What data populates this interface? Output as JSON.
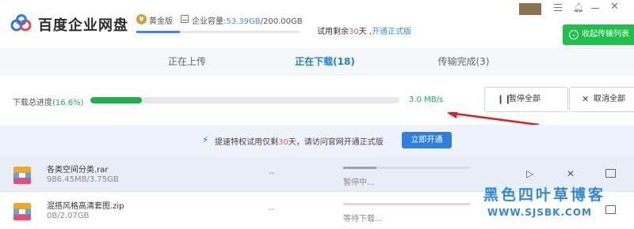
{
  "header": {
    "brand": "百度企业网盘",
    "vip_badge": "¥",
    "vip_label": "黄金版",
    "capacity_label": "企业容量:",
    "capacity_used": "53.39GB",
    "capacity_total": "/200.00GB",
    "capacity_fraction": 0.267,
    "trial_prefix": "试用剩余",
    "trial_days": "30",
    "trial_suffix": "天 ,",
    "trial_link": "开通正式版",
    "collapse_button": "收起传输列表",
    "icons": [
      "cloud-logo-icon",
      "menu-icon",
      "bell-icon",
      "minimize-icon",
      "close-icon",
      "collapse-icon"
    ]
  },
  "tabs": [
    {
      "label": "正在上传",
      "active": false
    },
    {
      "label": "正在下载(18)",
      "active": true
    },
    {
      "label": "传输完成(3)",
      "active": false
    }
  ],
  "progress": {
    "label": "下载总进度",
    "percent_text": "(16.6%)",
    "fraction": 0.166,
    "speed": "3.0 MB/s",
    "pause_all": "暂停全部",
    "cancel_all": "取消全部"
  },
  "promo": {
    "prefix": "提速特权试用仅剩",
    "days": "30",
    "suffix": "天，请访问官网开通正式版",
    "button": "立即开通"
  },
  "files": [
    {
      "name": "各类空间分类.rar",
      "size": "986.45MB/3.75GB",
      "speed": "--",
      "status": "暂停中...",
      "fraction": 0.26
    },
    {
      "name": "混搭风格高清套图.zip",
      "size": "0B/2.07GB",
      "speed": "--",
      "status": "等待下载...",
      "fraction": 0.0
    }
  ],
  "watermark": {
    "title": "黑色四叶草博客",
    "url": "WWW.SJSBK.COM"
  },
  "colors": {
    "accent_blue": "#1e7fe0",
    "progress_green": "#1ab34a",
    "highlight_red": "#f25c3c",
    "arrow_red": "#e02020"
  }
}
